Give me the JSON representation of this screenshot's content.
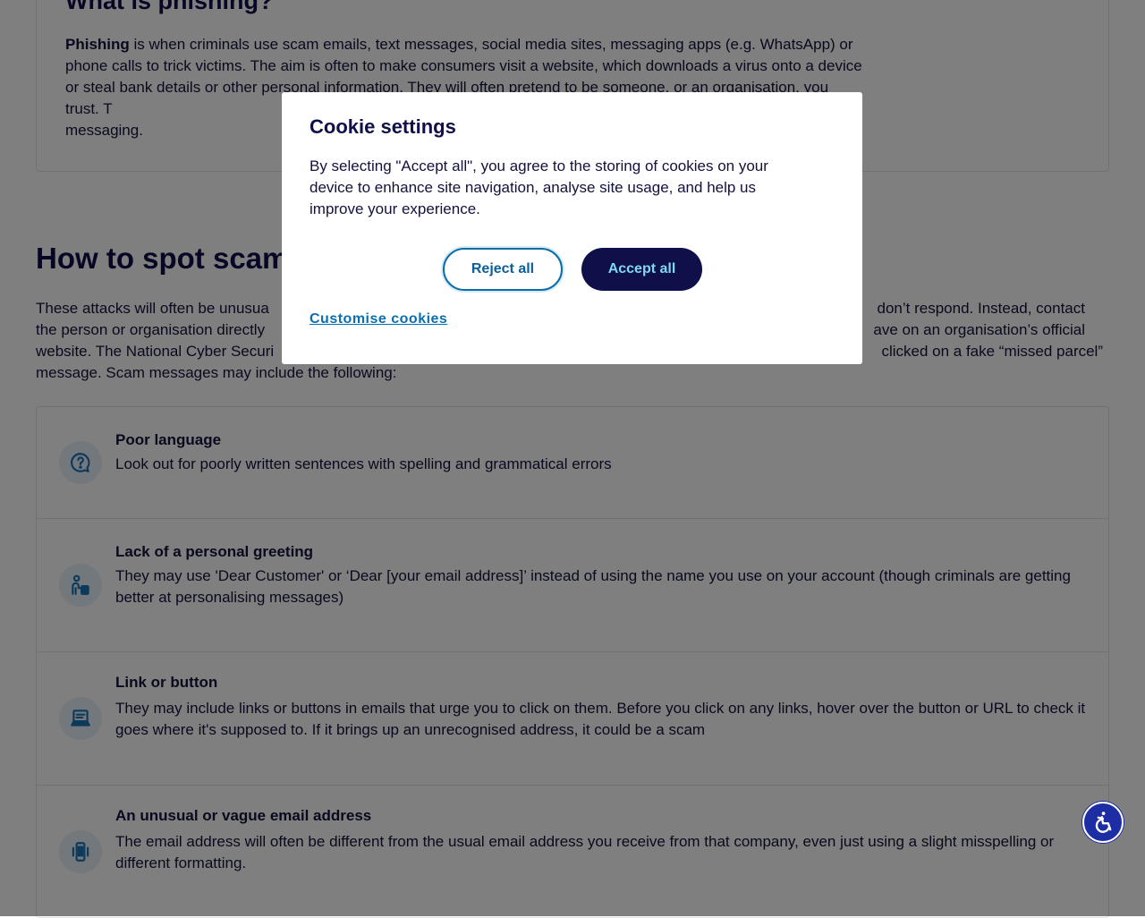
{
  "phishing": {
    "title": "What is phishing?",
    "term": "Phishing",
    "text": " is when criminals use scam emails, text messages, social media sites, messaging apps (e.g. WhatsApp) or phone calls to trick victims. The aim is often to make consumers visit a website, which downloads a virus onto a device or steal bank details or other personal information. They will often pretend to be someone, or an organisation, you trust. T",
    "text_end": "messaging."
  },
  "spot": {
    "title": "How to spot scam",
    "line1_start": "These attacks will often be unusua",
    "line1_end": "don’t respond. Instead, contact",
    "line2_start": "the person or organisation directly",
    "line2_end": "ave on an organisation’s official",
    "line3_start": "website. The National Cyber Securi",
    "line3_end": "clicked on a fake “missed parcel”",
    "line4": "message. Scam messages may include the following:"
  },
  "signs": [
    {
      "icon": "question-bubble-icon",
      "title": "Poor language",
      "description": "Look out for poorly written sentences with spelling and grammatical errors"
    },
    {
      "icon": "person-badge-icon",
      "title": "Lack of a personal greeting",
      "description": "They may use 'Dear Customer' or ‘Dear [your email address]’ instead of using the name you use on your account (though criminals are getting better at personalising messages)"
    },
    {
      "icon": "laptop-icon",
      "title": "Link or button",
      "description": "They may include links or buttons in emails that urge you to click on them. Before you click on any links, hover over the button or URL to check it goes where it's supposed to. If it brings up an unrecognised address, it could be a scam"
    },
    {
      "icon": "vibrating-phone-icon",
      "title": "An unusual or vague email address",
      "description": "The email address will often be different from the usual email address you receive from that company, even just using a slight misspelling or different formatting."
    }
  ],
  "cookie": {
    "title": "Cookie settings",
    "text": "By selecting \"Accept all\", you agree to the storing of cookies on your device to enhance site navigation, analyse site usage, and help us improve your experience.",
    "reject_label": "Reject all",
    "accept_label": "Accept all",
    "customise_label": "Customise cookies"
  },
  "accessibility": {
    "icon": "accessibility-icon"
  },
  "colors": {
    "navy": "#0f0f4a",
    "link_blue": "#0a6fb0",
    "accept_text": "#7fd8f4",
    "icon_blue": "#1a73b5",
    "icon_bg": "#e6f1f9",
    "a11y_blue": "#1d2da3"
  }
}
